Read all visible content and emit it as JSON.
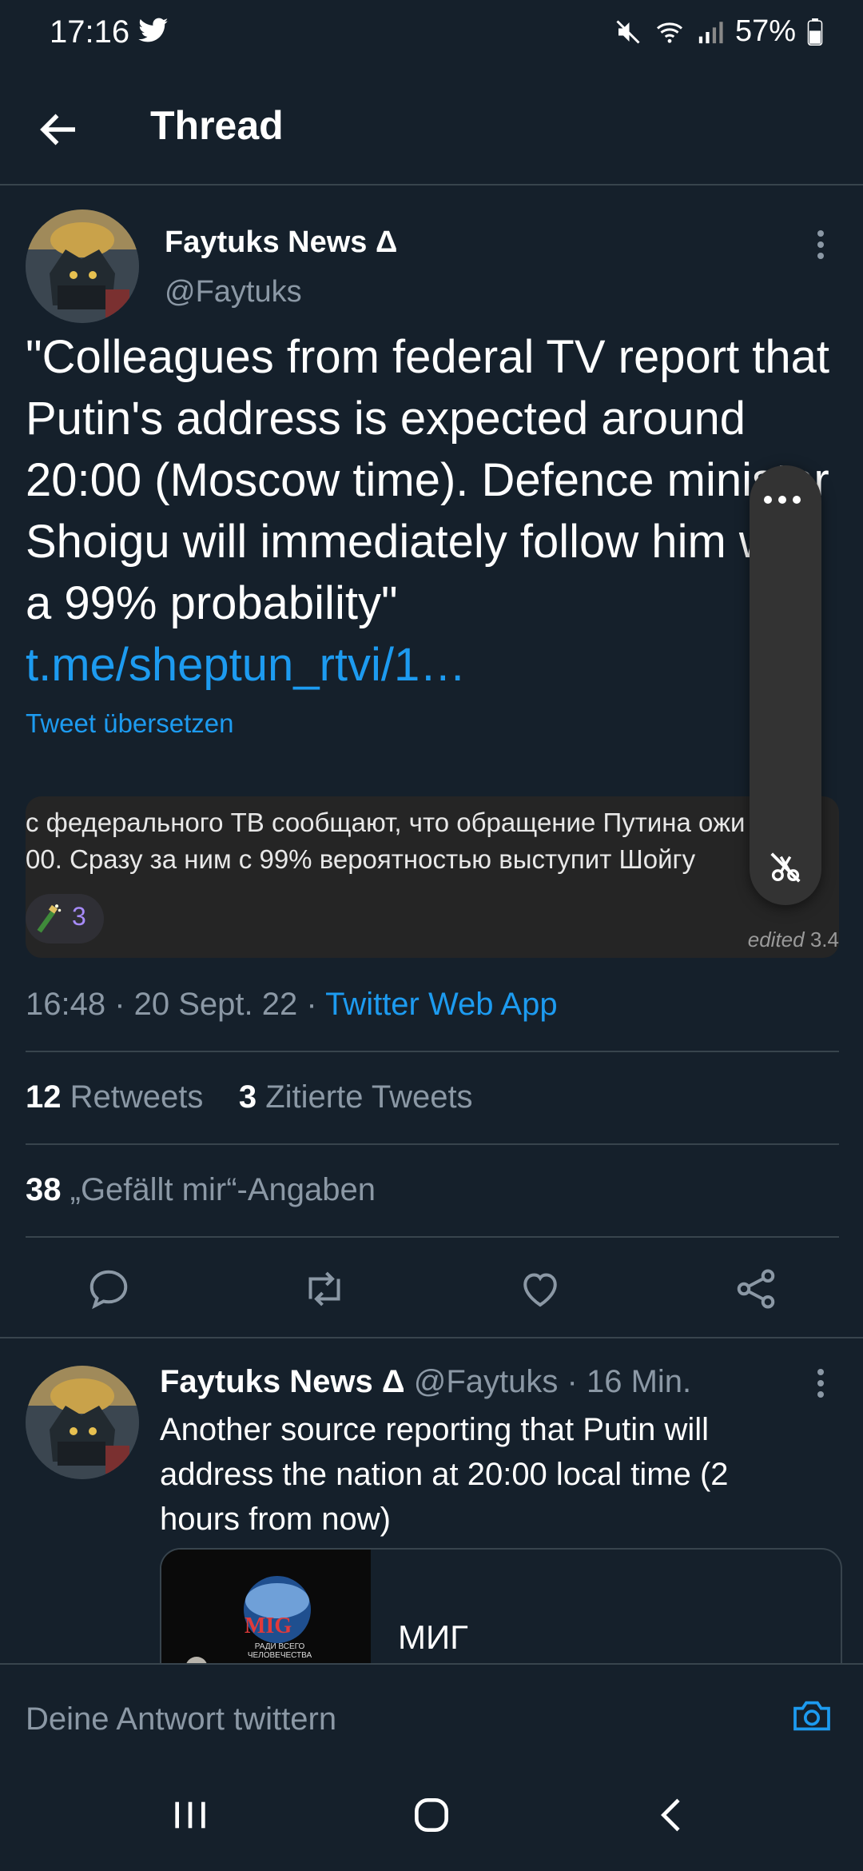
{
  "status_bar": {
    "time": "17:16",
    "battery": "57%"
  },
  "header": {
    "title": "Thread"
  },
  "main_tweet": {
    "author_name": "Faytuks News Δ",
    "author_handle": "@Faytuks",
    "text": "\"Colleagues from federal TV report that Putin's address is expected around 20:00 (Moscow time). Defence minister Shoigu will immediately follow him with a 99% probability\" ",
    "link_text": "t.me/sheptun_rtvi/1…",
    "translate_label": "Tweet übersetzen",
    "embed": {
      "line1": "с федерального ТВ сообщают, что обращение Путина ожи",
      "line2": "00. Сразу за ним с 99% вероятностью выступит Шойгу",
      "reaction_count": "3",
      "edited_label": "edited",
      "edited_value": "3.4"
    },
    "timestamp": "16:48 · 20 Sept. 22 · ",
    "source": "Twitter Web App",
    "retweets_count": "12",
    "retweets_label": "Retweets",
    "quotes_count": "3",
    "quotes_label": "Zitierte Tweets",
    "likes_count": "38",
    "likes_label": "„Gefällt mir“-Angaben"
  },
  "reply_tweet": {
    "author_name": "Faytuks News Δ",
    "author_handle": "@Faytuks",
    "time": "· 16 Min.",
    "text": "Another source reporting that Putin will address the nation at 20:00 local time (2 hours from now)",
    "card_title": "МИГ",
    "card_logo_text": "MIG",
    "card_logo_sub": "РАДИ ВСЕГО ЧЕЛОВЕЧЕСТВА"
  },
  "compose": {
    "placeholder": "Deine Antwort twittern"
  },
  "colors": {
    "background": "#15202b",
    "accent": "#1d9bf0",
    "secondary_text": "#8b98a5",
    "divider": "#38444d"
  },
  "icons": [
    "twitter-bird-icon",
    "mute-icon",
    "wifi-icon",
    "signal-icon",
    "battery-icon",
    "back-arrow-icon",
    "more-vert-icon",
    "more-horiz-icon",
    "mute-media-icon",
    "reply-icon",
    "retweet-icon",
    "like-icon",
    "share-icon",
    "camera-icon",
    "recents-icon",
    "home-icon",
    "nav-back-icon"
  ]
}
